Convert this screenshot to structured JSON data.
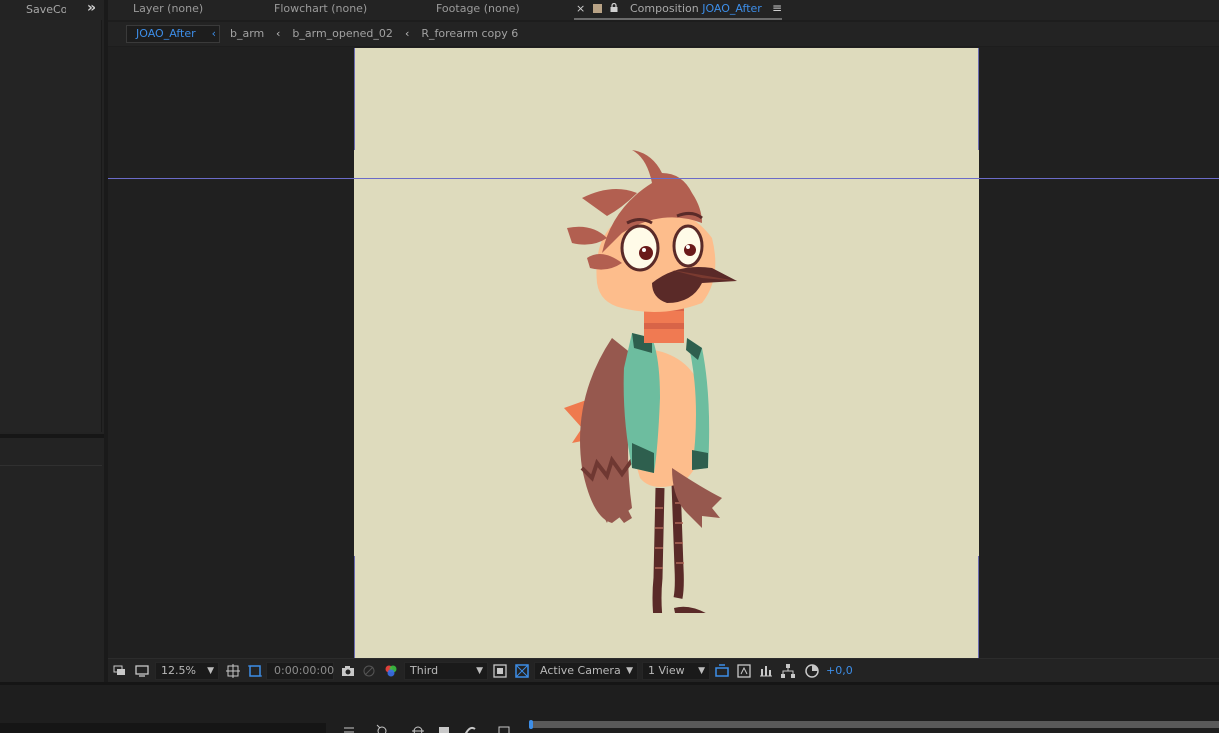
{
  "left_panel": {
    "tab_label": "SaveCo",
    "overflow_icon": "double-chevron-right"
  },
  "tabs": [
    {
      "label": "Layer (none)"
    },
    {
      "label": "Flowchart (none)"
    },
    {
      "label": "Footage (none)"
    }
  ],
  "composition_tab": {
    "close": "×",
    "prefix": "Composition ",
    "name": "JOAO_After",
    "menu": "≡",
    "swatch_color": "#b9a386"
  },
  "breadcrumbs": [
    {
      "label": "JOAO_After",
      "active": true
    },
    {
      "label": "b_arm"
    },
    {
      "label": "b_arm_opened_02"
    },
    {
      "label": "R_forearm copy 6"
    }
  ],
  "breadcrumb_separator": "‹",
  "toolbar": {
    "magnification": "12.5%",
    "timecode": "0:00:00:00",
    "resolution": "Third",
    "camera": "Active Camera",
    "views": "1 View",
    "exposure": "+0,0"
  },
  "colors": {
    "accent": "#3d8ee8",
    "canvas": "#dedbbd",
    "guide": "#6b6bc8"
  },
  "canvas": {
    "content": "cartoon bird character"
  }
}
